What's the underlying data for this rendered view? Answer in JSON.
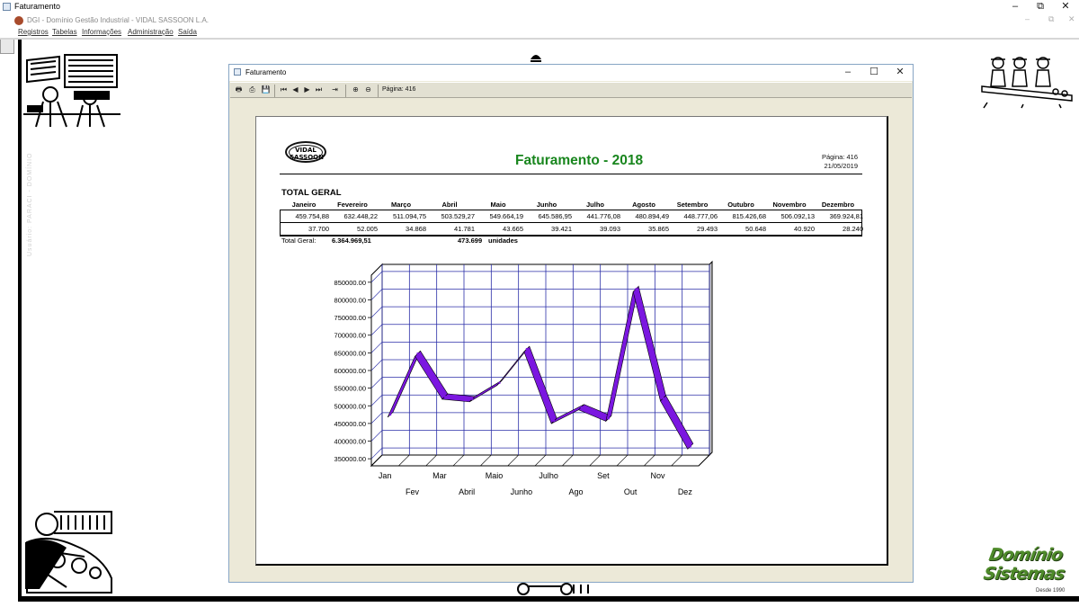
{
  "app": {
    "title": "Faturamento",
    "inner_title": "DGI - Domínio Gestão Industrial - VIDAL SASSOON L.A.",
    "window_controls": [
      "–",
      "⧉",
      "✕"
    ],
    "inner_controls": [
      "–",
      "⧉",
      "✕"
    ]
  },
  "menu": {
    "items": [
      "Registros",
      "Tabelas",
      "Informações",
      "Administração",
      "Saída"
    ]
  },
  "side_watermark": "Usuário: PARACI - DOMÍNIO",
  "brand": {
    "line1": "Domínio",
    "line2": "Sistemas",
    "since": "Desde 1990"
  },
  "doc_window": {
    "title": "Faturamento",
    "controls": [
      "–",
      "☐",
      "✕"
    ],
    "toolbar": {
      "buttons": [
        {
          "name": "print-setup-icon",
          "glyph": "🖶"
        },
        {
          "name": "print-icon",
          "glyph": "⎙"
        },
        {
          "name": "save-icon",
          "glyph": "💾"
        },
        {
          "name": "first-page-icon",
          "glyph": "⏮"
        },
        {
          "name": "prev-page-icon",
          "glyph": "◀"
        },
        {
          "name": "next-page-icon",
          "glyph": "▶"
        },
        {
          "name": "last-page-icon",
          "glyph": "⏭"
        },
        {
          "name": "goto-page-icon",
          "glyph": "⇥"
        },
        {
          "name": "zoom-in-icon",
          "glyph": "⊕"
        },
        {
          "name": "zoom-out-icon",
          "glyph": "⊖"
        }
      ],
      "page_label": "Página: 416"
    }
  },
  "report": {
    "logo_text_1": "VIDAL",
    "logo_text_2": "SASSOON",
    "title": "Faturamento - 2018",
    "page": "Página: 416",
    "date": "21/05/2019",
    "section": "TOTAL GERAL",
    "months": [
      "Janeiro",
      "Fevereiro",
      "Março",
      "Abril",
      "Maio",
      "Junho",
      "Julho",
      "Agosto",
      "Setembro",
      "Outubro",
      "Novembro",
      "Dezembro"
    ],
    "values": [
      "459.754,88",
      "632.448,22",
      "511.094,75",
      "503.529,27",
      "549.664,19",
      "645.586,95",
      "441.776,08",
      "480.894,49",
      "448.777,06",
      "815.426,68",
      "506.092,13",
      "369.924,81"
    ],
    "units": [
      "37.700",
      "52.005",
      "34.868",
      "41.781",
      "43.665",
      "39.421",
      "39.093",
      "35.865",
      "29.493",
      "50.648",
      "40.920",
      "28.240"
    ],
    "total_label": "Total Geral:",
    "total_value": "6.364.969,51",
    "total_units": "473.699",
    "units_label": "unidades"
  },
  "chart_data": {
    "type": "line",
    "categories": [
      "Jan",
      "Fev",
      "Mar",
      "Abril",
      "Maio",
      "Junho",
      "Julho",
      "Ago",
      "Set",
      "Out",
      "Nov",
      "Dez"
    ],
    "series": [
      {
        "values": [
          459754.88,
          632448.22,
          511094.75,
          503529.27,
          549664.19,
          645586.95,
          441776.08,
          480894.49,
          448777.06,
          815426.68,
          506092.13,
          369924.81
        ]
      }
    ],
    "ytick_labels": [
      "850000.00",
      "800000.00",
      "750000.00",
      "700000.00",
      "650000.00",
      "600000.00",
      "550000.00",
      "500000.00",
      "450000.00",
      "400000.00",
      "350000.00"
    ],
    "ylim": [
      330000,
      870000
    ],
    "grid": true,
    "style_3d": true,
    "line_color": "#7b17e0"
  }
}
